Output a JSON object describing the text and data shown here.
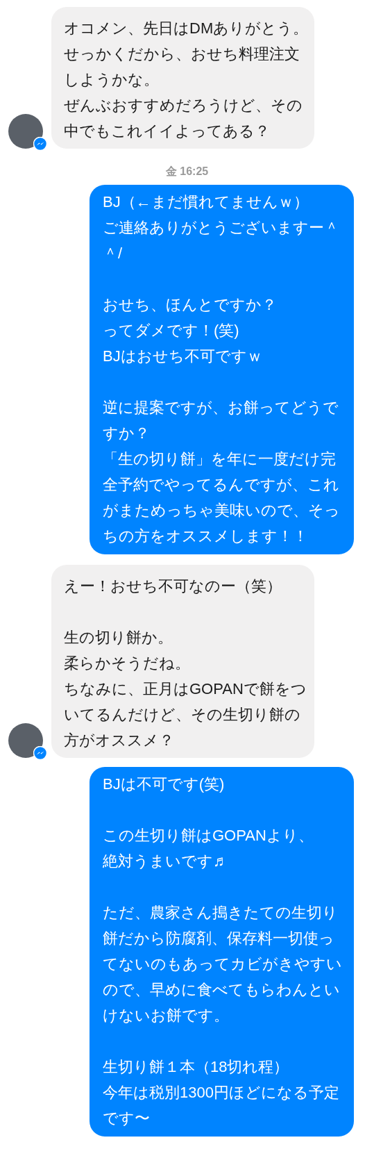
{
  "messages": [
    {
      "kind": "received",
      "blocks": [
        [
          "オコメン、先日はDMありがとう。",
          "せっかくだから、おせち料理注文しようかな。",
          "ぜんぶおすすめだろうけど、その中でもこれイイよってある？"
        ]
      ]
    },
    {
      "kind": "timestamp",
      "text": "金 16:25"
    },
    {
      "kind": "sent",
      "blocks": [
        [
          "BJ（←まだ慣れてませんｗ）",
          "ご連絡ありがとうございますー＾＾/"
        ],
        [
          "おせち、ほんとですか？",
          "ってダメです！(笑)",
          "BJはおせち不可ですｗ"
        ],
        [
          "逆に提案ですが、お餅ってどうですか？",
          "「生の切り餅」を年に一度だけ完全予約でやってるんですが、これがまためっちゃ美味いので、そっちの方をオススメします！！"
        ]
      ]
    },
    {
      "kind": "received",
      "blocks": [
        [
          "えー！おせち不可なのー（笑）"
        ],
        [
          "生の切り餅か。",
          "柔らかそうだね。",
          "ちなみに、正月はGOPANで餅をついてるんだけど、その生切り餅の方がオススメ？"
        ]
      ]
    },
    {
      "kind": "sent",
      "blocks": [
        [
          "BJは不可です(笑)"
        ],
        [
          "この生切り餅はGOPANより、",
          "絶対うまいです♬"
        ],
        [
          "ただ、農家さん搗きたての生切り餅だから防腐剤、保存料一切使ってないのもあってカビがきやすいので、早めに食べてもらわんといけないお餅です。"
        ],
        [
          "生切り餅１本（18切れ程）",
          "今年は税別1300円ほどになる予定です〜"
        ]
      ]
    }
  ]
}
